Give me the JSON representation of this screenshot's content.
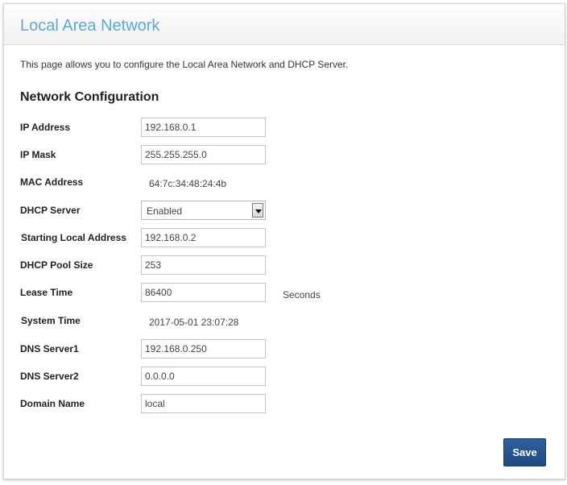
{
  "page": {
    "title": "Local Area Network",
    "intro": "This page allows you to configure the Local Area Network and DHCP Server."
  },
  "network": {
    "section_title": "Network Configuration",
    "ip_address": {
      "label": "IP Address",
      "value": "192.168.0.1"
    },
    "ip_mask": {
      "label": "IP Mask",
      "value": "255.255.255.0"
    },
    "mac_address": {
      "label": "MAC Address",
      "value": "64:7c:34:48:24:4b"
    },
    "dhcp_server": {
      "label": "DHCP Server",
      "value": "Enabled"
    },
    "starting_local_address": {
      "label": "Starting Local Address",
      "value": "192.168.0.2"
    },
    "dhcp_pool_size": {
      "label": "DHCP Pool Size",
      "value": "253"
    },
    "lease_time": {
      "label": "Lease Time",
      "value": "86400",
      "unit": "Seconds"
    },
    "system_time": {
      "label": "System Time",
      "value": "2017-05-01 23:07:28"
    },
    "dns_server1": {
      "label": "DNS Server1",
      "value": "192.168.0.250"
    },
    "dns_server2": {
      "label": "DNS Server2",
      "value": "0.0.0.0"
    },
    "domain_name": {
      "label": "Domain Name",
      "value": "local"
    }
  },
  "actions": {
    "save_label": "Save"
  },
  "colors": {
    "title": "#5aa9d6",
    "save_button": "#1e4a82"
  }
}
